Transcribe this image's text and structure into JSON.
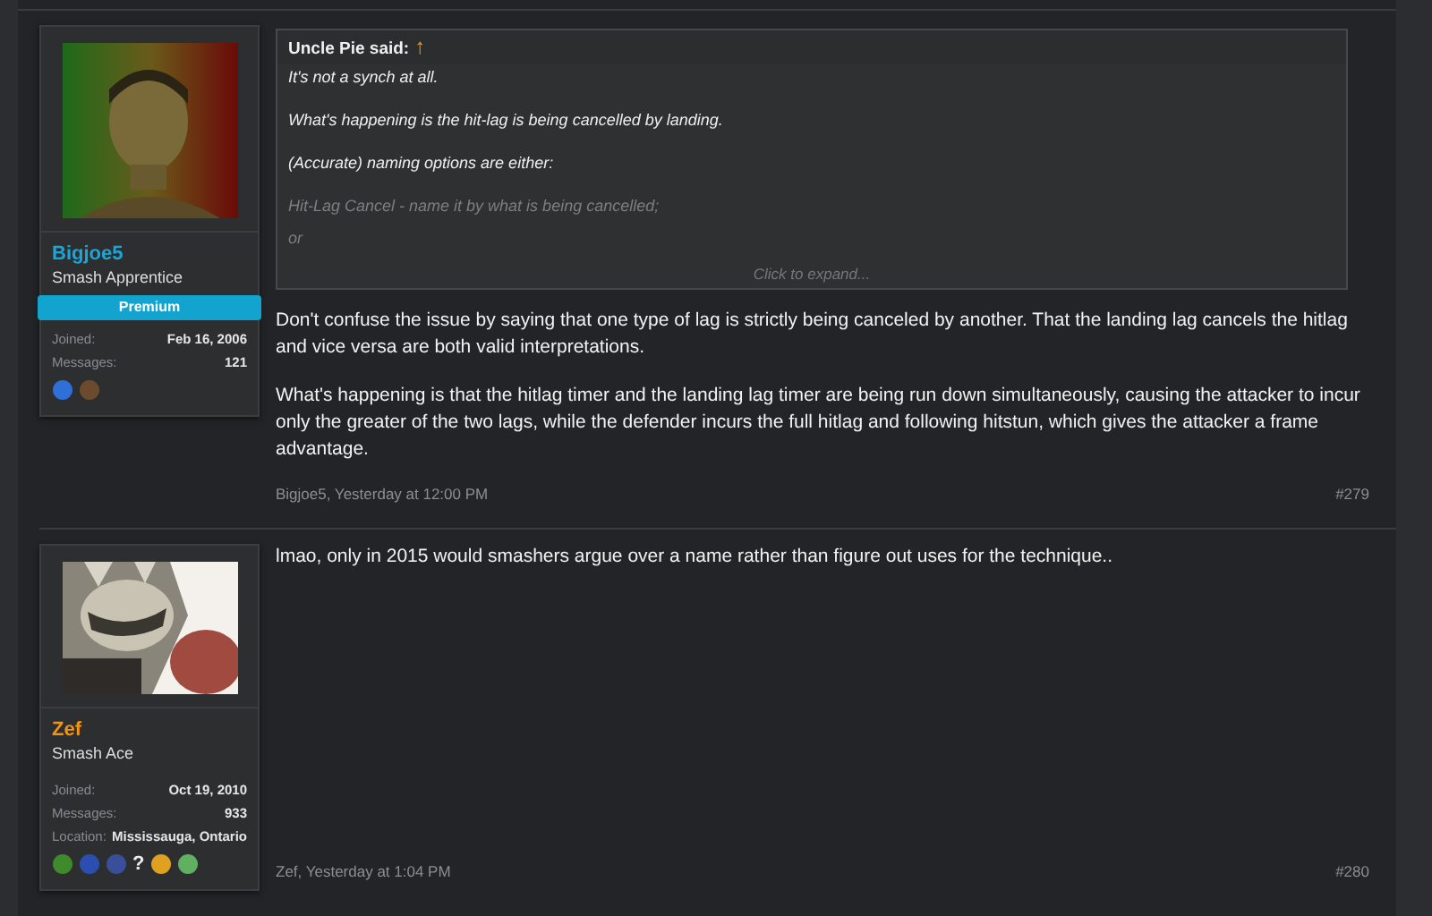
{
  "posts": [
    {
      "user": {
        "name": "Bigjoe5",
        "color": "#1aa6d6",
        "title": "Smash Apprentice",
        "banner": "Premium",
        "stats": [
          {
            "label": "Joined:",
            "value": "Feb 16, 2006"
          },
          {
            "label": "Messages:",
            "value": "121"
          }
        ],
        "badges": [
          {
            "kind": "sprite",
            "color": "#2f6fd8"
          },
          {
            "kind": "sprite",
            "color": "#6b4a2e"
          }
        ]
      },
      "quote": {
        "author": "Uncle Pie",
        "said": "said:",
        "arrow": "↑",
        "lines": [
          {
            "text": "It's not a synch at all.",
            "faded": false
          },
          {
            "text": "What's happening is the hit-lag is being cancelled by landing.",
            "faded": false
          },
          {
            "text": "(Accurate) naming options are either:",
            "faded": false
          },
          {
            "text": "Hit-Lag Cancel - name it by what is being cancelled;",
            "faded": true
          },
          {
            "text": "or",
            "faded": true
          }
        ],
        "expand": "Click to expand..."
      },
      "paragraphs": [
        "Don't confuse the issue by saying that one type of lag is strictly being canceled by another. That the landing lag cancels the hitlag and vice versa are both valid interpretations.",
        "What's happening is that the hitlag timer and the landing lag timer are being run down simultaneously, causing the attacker to incur only the greater of the two lags, while the defender incurs the full hitlag and following hitstun, which gives the attacker a frame advantage."
      ],
      "byline": "Bigjoe5, Yesterday at 12:00 PM",
      "number": "#279"
    },
    {
      "user": {
        "name": "Zef",
        "color": "#f29412",
        "title": "Smash Ace",
        "stats": [
          {
            "label": "Joined:",
            "value": "Oct 19, 2010"
          },
          {
            "label": "Messages:",
            "value": "933"
          },
          {
            "label": "Location:",
            "value": "Mississauga, Ontario"
          }
        ],
        "badges": [
          {
            "kind": "sprite",
            "color": "#3f8a2a"
          },
          {
            "kind": "sprite",
            "color": "#2a4fb0"
          },
          {
            "kind": "sprite",
            "color": "#3a4f9a"
          },
          {
            "kind": "glyph",
            "text": "?"
          },
          {
            "kind": "sprite",
            "color": "#e0a020"
          },
          {
            "kind": "sprite",
            "color": "#5fb060"
          }
        ]
      },
      "paragraphs": [
        "lmao, only in 2015 would smashers argue over a name rather than figure out uses for the technique.."
      ],
      "byline": "Zef, Yesterday at 1:04 PM",
      "number": "#280"
    }
  ]
}
